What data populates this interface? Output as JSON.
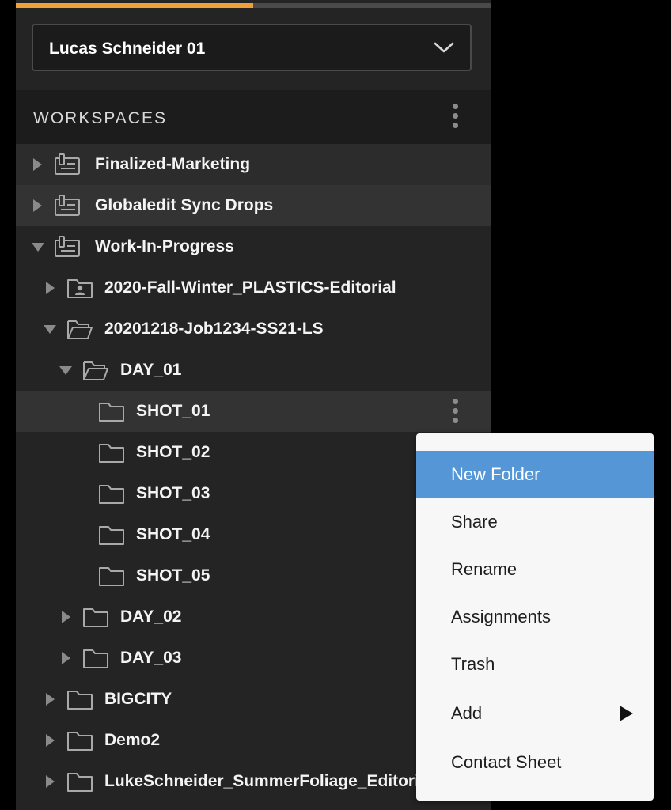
{
  "colors": {
    "accent": "#f0a03a",
    "menu_highlight": "#5596d6",
    "panel_bg": "#242424"
  },
  "progress": {
    "fraction": 0.5
  },
  "account": {
    "name": "Lucas Schneider 01",
    "icon": "chevron-down-icon"
  },
  "workspaces": {
    "title": "WORKSPACES",
    "tree": [
      {
        "label": "Finalized-Marketing",
        "icon": "workspace-icon",
        "expanded": false
      },
      {
        "label": "Globaledit Sync Drops",
        "icon": "workspace-icon",
        "expanded": false
      },
      {
        "label": "Work-In-Progress",
        "icon": "workspace-icon",
        "expanded": true
      },
      {
        "label": "2020-Fall-Winter_PLASTICS-Editorial",
        "icon": "shared-folder-icon",
        "expanded": false
      },
      {
        "label": "20201218-Job1234-SS21-LS",
        "icon": "open-folder-icon",
        "expanded": true
      },
      {
        "label": "DAY_01",
        "icon": "open-folder-icon",
        "expanded": true
      },
      {
        "label": "SHOT_01",
        "icon": "folder-icon",
        "selected": true
      },
      {
        "label": "SHOT_02",
        "icon": "folder-icon"
      },
      {
        "label": "SHOT_03",
        "icon": "folder-icon"
      },
      {
        "label": "SHOT_04",
        "icon": "folder-icon"
      },
      {
        "label": "SHOT_05",
        "icon": "folder-icon"
      },
      {
        "label": "DAY_02",
        "icon": "folder-icon",
        "expanded": false
      },
      {
        "label": "DAY_03",
        "icon": "folder-icon",
        "expanded": false
      },
      {
        "label": "BIGCITY",
        "icon": "folder-icon",
        "expanded": false
      },
      {
        "label": "Demo2",
        "icon": "folder-icon",
        "expanded": false
      },
      {
        "label": "LukeSchneider_SummerFoliage_Editorial",
        "icon": "folder-icon",
        "expanded": false
      }
    ]
  },
  "context_menu": {
    "items": [
      {
        "label": "New Folder",
        "highlighted": true
      },
      {
        "label": "Share"
      },
      {
        "label": "Rename"
      },
      {
        "label": "Assignments"
      },
      {
        "label": "Trash"
      },
      {
        "label": "Add",
        "has_submenu": true
      },
      {
        "label": "Contact Sheet"
      }
    ]
  }
}
